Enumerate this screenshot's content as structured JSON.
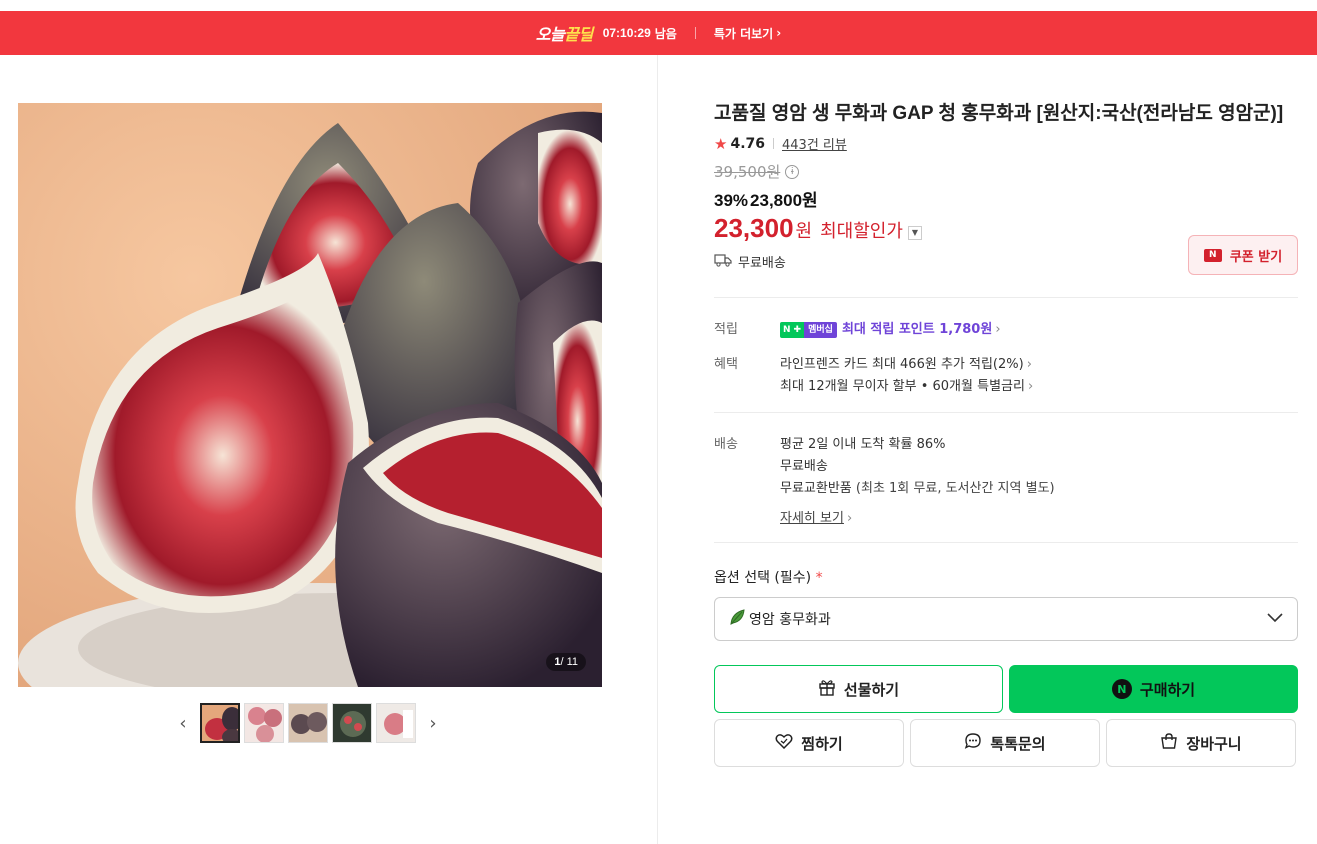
{
  "banner": {
    "brand_a": "오늘",
    "brand_b": "끝딜",
    "timer": "07:10:29",
    "remain": "남음",
    "more_link": "특가 더보기",
    "color": "#f2373e"
  },
  "gallery": {
    "counter_current": "1",
    "counter_total": "/ 11",
    "thumbnails": [
      "fig-thumb-1",
      "fig-thumb-2",
      "fig-thumb-3",
      "fig-thumb-4",
      "fig-thumb-5"
    ]
  },
  "product": {
    "title": "고품질 영암 생 무화과 GAP 청 홍무화과 [원산지:국산(전라남도 영암군)]",
    "rating": "4.76",
    "review_count": "443건 리뷰",
    "original_price": "39,500원",
    "discount_rate": "39%",
    "sale_price": "23,800원",
    "max_price": "23,300",
    "max_unit": "원",
    "max_label": "최대할인가",
    "coupon_label": "쿠폰 받기",
    "shipping_label": "무료배송",
    "accent_color": "#d3212d"
  },
  "details": {
    "points_label": "적립",
    "points_badge_n": "N",
    "points_badge_mem": "멤버십",
    "points_text": "최대 적립 포인트 1,780원",
    "benefit_label": "혜택",
    "benefit_1": "라인프렌즈 카드 최대 466원 추가 적립(2%)",
    "benefit_2": "최대 12개월 무이자 할부 • 60개월 특별금리",
    "delivery_label": "배송",
    "delivery_1": "평균 2일 이내 도착 확률 86%",
    "delivery_2": "무료배송",
    "delivery_3_main": "무료교환반품",
    "delivery_3_sub": "(최초 1회 무료, 도서산간 지역 별도)",
    "more_details": "자세히 보기"
  },
  "options": {
    "label": "옵션 선택 (필수)",
    "required_mark": "*",
    "selected": "영암 홍무화과"
  },
  "actions": {
    "gift": "선물하기",
    "buy": "구매하기",
    "npay_mark": "N",
    "wish": "찜하기",
    "talk": "톡톡문의",
    "cart": "장바구니",
    "buy_color": "#03c75a"
  }
}
